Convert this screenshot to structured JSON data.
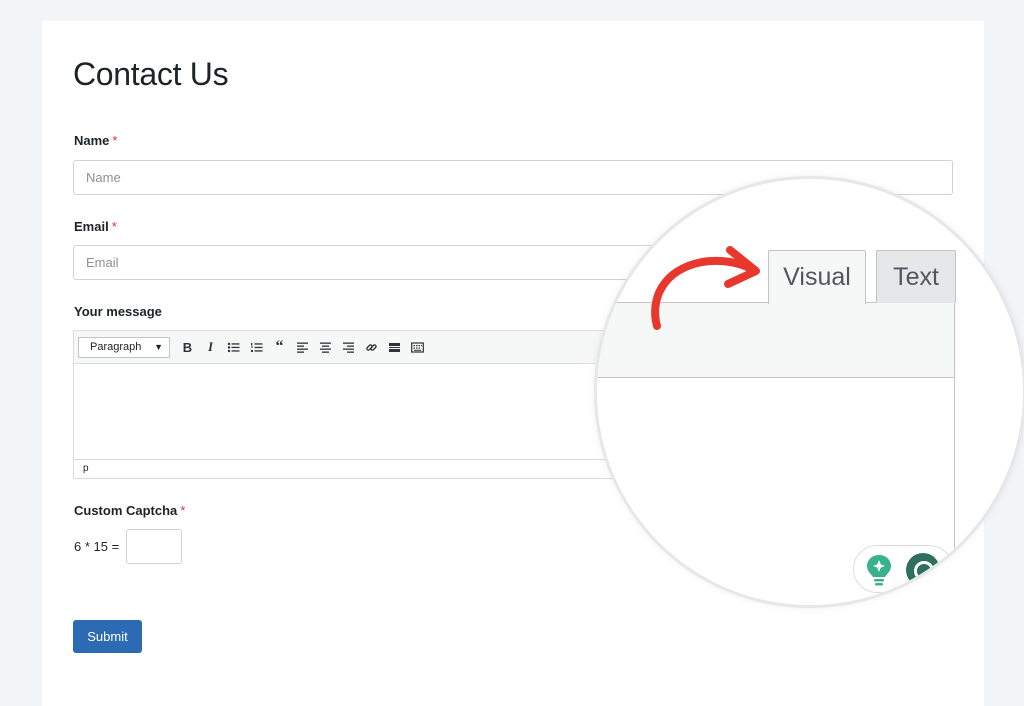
{
  "form": {
    "title": "Contact Us",
    "name": {
      "label": "Name",
      "required_mark": "*",
      "placeholder": "Name"
    },
    "email": {
      "label": "Email",
      "required_mark": "*",
      "placeholder": "Email"
    },
    "message": {
      "label": "Your message",
      "format_select": "Paragraph",
      "statusbar_path": "p",
      "toolbar_icons": [
        "bold-icon",
        "italic-icon",
        "bullet-list-icon",
        "numbered-list-icon",
        "blockquote-icon",
        "align-left-icon",
        "align-center-icon",
        "align-right-icon",
        "link-icon",
        "read-more-icon",
        "toolbar-toggle-icon"
      ]
    },
    "captcha": {
      "label": "Custom Captcha",
      "required_mark": "*",
      "question": "6 * 15 ="
    },
    "submit_label": "Submit"
  },
  "magnifier": {
    "tab_visual": "Visual",
    "tab_text": "Text",
    "arrow_color": "#e8372c"
  },
  "colors": {
    "accent": "#2c6bb4",
    "required": "#d63638",
    "grammarly_bulb": "#39b28c",
    "grammarly_ring": "#2f6f5e"
  }
}
